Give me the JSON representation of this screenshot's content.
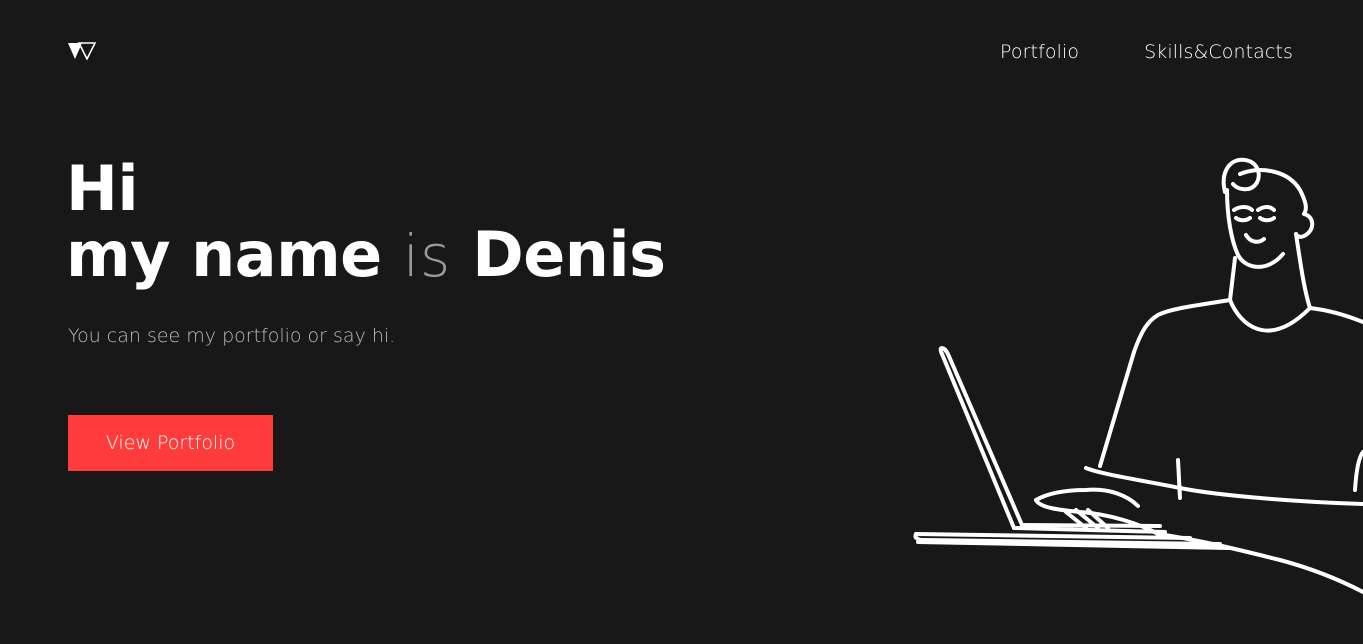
{
  "nav": {
    "items": [
      {
        "label": "Portfolio"
      },
      {
        "label": "Skills&Contacts"
      }
    ]
  },
  "hero": {
    "line1": "Hi",
    "line2_part1": "my name",
    "line2_part2": "is",
    "line2_part3": "Denis",
    "subtitle": "You can see my portfolio or say hi.",
    "cta_label": "View Portfolio"
  },
  "colors": {
    "background": "#181818",
    "accent": "#ff3b3b",
    "text": "#ffffff",
    "muted": "#bcbcbc"
  },
  "icons": {
    "logo": "w-triangle-logo"
  }
}
